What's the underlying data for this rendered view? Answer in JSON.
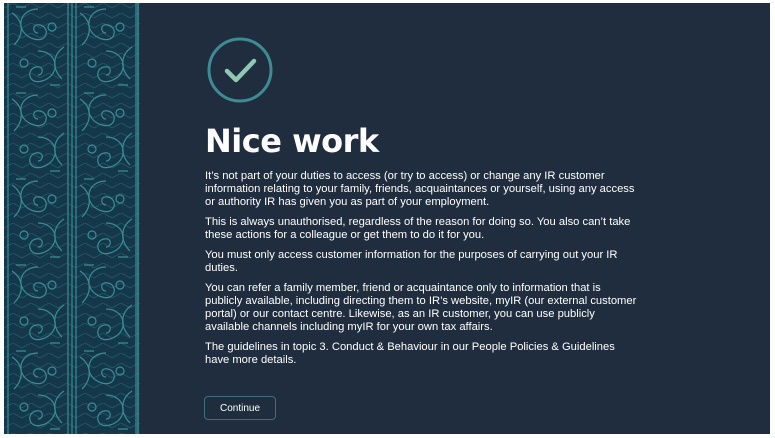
{
  "icons": {
    "success": "check-circle-icon",
    "pattern": "kowhaiwhai-pattern"
  },
  "colors": {
    "background": "#1f2d3f",
    "pattern_bg": "#14384a",
    "pattern_line": "#3a8d93",
    "accent": "#8fc7b4",
    "text": "#ffffff"
  },
  "page": {
    "title": "Nice work",
    "paragraphs": [
      "It’s not part of your duties to access (or try to access) or change any IR customer information relating to your family, friends, acquaintances or yourself, using any access or authority IR has given you as part of your employment.",
      "This is always unauthorised, regardless of the reason for doing so. You also can’t take these actions for a colleague or get them to do it for you.",
      "You must only access customer information for the purposes of carrying out your IR duties.",
      "You can refer a family member, friend or acquaintance only to information that is publicly available, including directing them to IR’s website, myIR (our external customer portal) or our contact centre. Likewise, as an IR customer, you can use publicly available channels including myIR for your own tax affairs.",
      "The guidelines in topic 3. Conduct & Behaviour in our People Policies & Guidelines have more details."
    ],
    "continue_label": "Continue"
  }
}
